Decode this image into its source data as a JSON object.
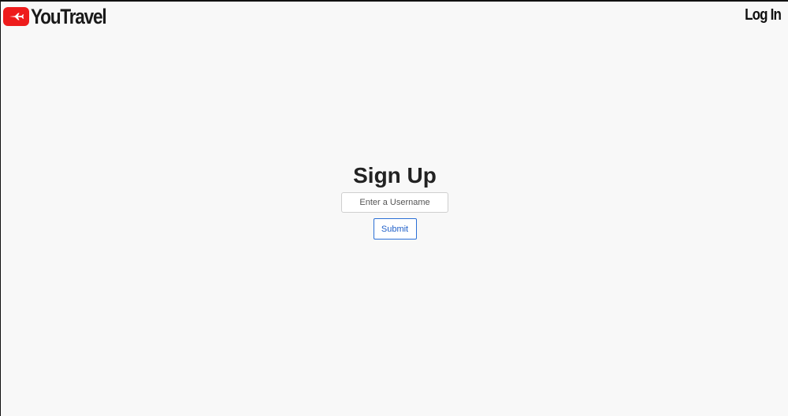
{
  "header": {
    "logo_text": "YouTravel",
    "logo_icon": "airplane-icon",
    "logo_color": "#ee1c1c",
    "login_label": "Log In"
  },
  "signup": {
    "title": "Sign Up",
    "username_placeholder": "Enter a Username",
    "username_value": "",
    "submit_label": "Submit"
  },
  "colors": {
    "background": "#f8f8f8",
    "accent": "#2b6fd6"
  }
}
